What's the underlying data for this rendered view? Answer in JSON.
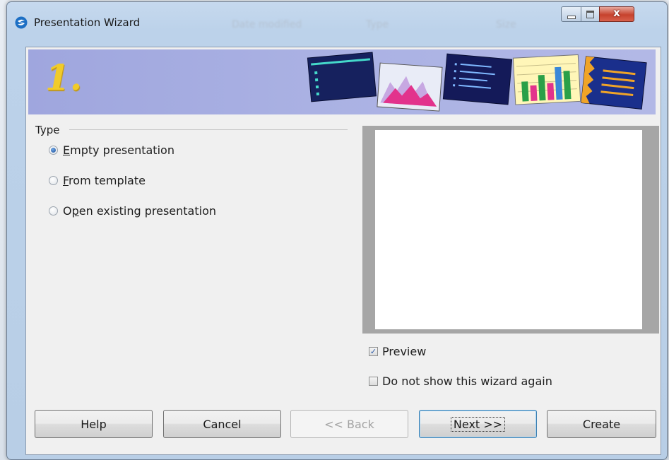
{
  "window": {
    "title": "Presentation Wizard",
    "background_columns": [
      "Date modified",
      "Type",
      "Size"
    ],
    "close_glyph": "x"
  },
  "banner": {
    "step_number": "1."
  },
  "type_group": {
    "label": "Type",
    "options": [
      {
        "label": "Empty presentation",
        "mnemonic": "E",
        "rest": "mpty presentation",
        "selected": true
      },
      {
        "label": "From template",
        "mnemonic": "F",
        "rest": "rom template",
        "selected": false
      },
      {
        "label": "Open existing presentation",
        "prefix": "O",
        "mnemonic": "p",
        "rest": "en existing presentation",
        "selected": false
      }
    ]
  },
  "preview": {
    "checkbox_label": "Preview",
    "checked": true
  },
  "do_not_show": {
    "checkbox_label": "Do not show this wizard again",
    "checked": false
  },
  "buttons": {
    "help": "Help",
    "cancel": "Cancel",
    "back": "<< Back",
    "next": "Next >>",
    "create": "Create"
  },
  "colors": {
    "banner": "#aab1e3",
    "step_number": "#f1cb2a",
    "close_button": "#c6422d",
    "preview_frame": "#a6a6a6"
  },
  "icons": [
    "app-logo-icon",
    "minimize-icon",
    "maximize-icon",
    "close-icon",
    "slide-thumbnail-icons"
  ]
}
